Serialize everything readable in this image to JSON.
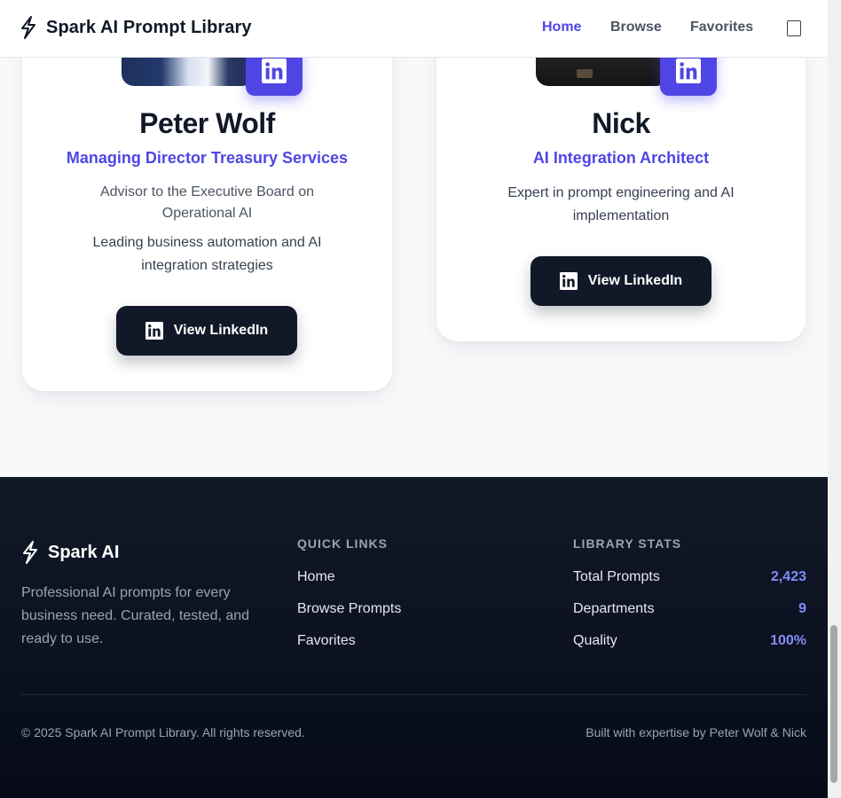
{
  "header": {
    "logo_icon": "lightning-bolt-icon",
    "title": "Spark AI Prompt Library",
    "nav": [
      {
        "label": "Home",
        "active": true
      },
      {
        "label": "Browse",
        "active": false
      },
      {
        "label": "Favorites",
        "active": false
      }
    ],
    "menu_icon": "menu-icon"
  },
  "team": [
    {
      "name": "Peter Wolf",
      "role": "Managing Director Treasury Services",
      "description": "Advisor to the Executive Board on Operational AI",
      "detail": "Leading business automation and AI integration strategies",
      "badge_icon": "linkedin-icon",
      "button_label": "View LinkedIn"
    },
    {
      "name": "Nick",
      "role": "AI Integration Architect",
      "description": "Expert in prompt engineering and AI implementation",
      "badge_icon": "linkedin-icon",
      "button_label": "View LinkedIn"
    }
  ],
  "footer": {
    "brand": "Spark AI",
    "tagline": "Professional AI prompts for every business need. Curated, tested, and ready to use.",
    "quick_links": {
      "heading": "QUICK LINKS",
      "items": [
        "Home",
        "Browse Prompts",
        "Favorites"
      ]
    },
    "stats": {
      "heading": "LIBRARY STATS",
      "items": [
        {
          "label": "Total Prompts",
          "value": "2,423"
        },
        {
          "label": "Departments",
          "value": "9"
        },
        {
          "label": "Quality",
          "value": "100%"
        }
      ]
    },
    "copyright": "© 2025 Spark AI Prompt Library. All rights reserved.",
    "credit": "Built with expertise by Peter Wolf & Nick"
  },
  "colors": {
    "accent": "#4f46e5",
    "stat_value": "#818cf8",
    "dark_button": "#111827",
    "footer_bg": "#0b1120"
  }
}
